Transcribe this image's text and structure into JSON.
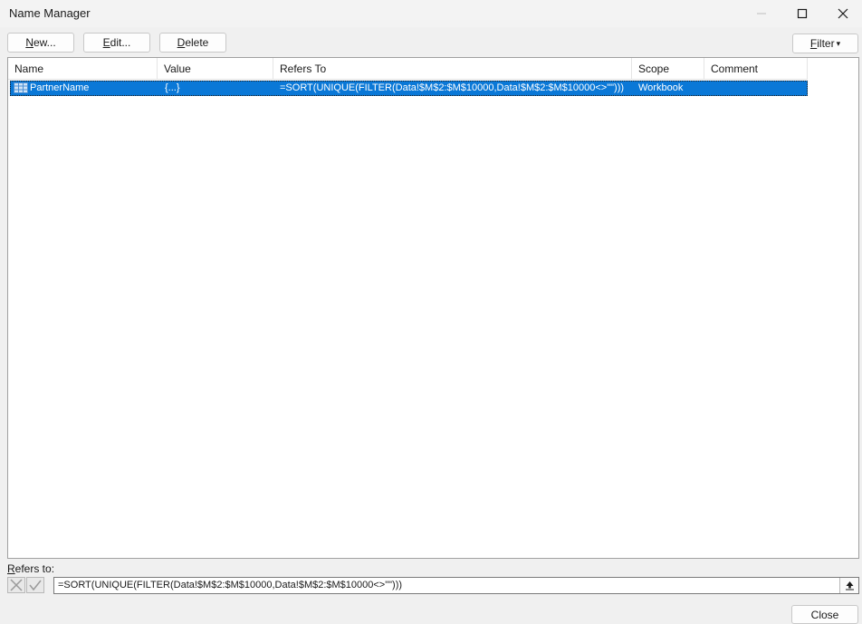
{
  "window": {
    "title": "Name Manager"
  },
  "toolbar": {
    "new_label_mnemonic": "N",
    "new_label_rest": "ew...",
    "edit_label_mnemonic": "E",
    "edit_label_rest": "dit...",
    "delete_label_mnemonic": "D",
    "delete_label_rest": "elete",
    "filter_label_mnemonic": "F",
    "filter_label_rest": "ilter",
    "filter_arrow": "▾"
  },
  "columns": [
    "Name",
    "Value",
    "Refers To",
    "Scope",
    "Comment"
  ],
  "rows": [
    {
      "name": "PartnerName",
      "value": "{...}",
      "refers_to": "=SORT(UNIQUE(FILTER(Data!$M$2:$M$10000,Data!$M$2:$M$10000<>\"\")))",
      "scope": "Workbook",
      "comment": "",
      "selected": true,
      "icon": "named-range-icon"
    }
  ],
  "refers_to": {
    "label_mnemonic": "R",
    "label_rest": "efers to:",
    "value": "=SORT(UNIQUE(FILTER(Data!$M$2:$M$10000,Data!$M$2:$M$10000<>\"\")))"
  },
  "footer": {
    "close_label": "Close"
  },
  "colors": {
    "selection": "#0a78d7",
    "background": "#f0f0f0"
  }
}
